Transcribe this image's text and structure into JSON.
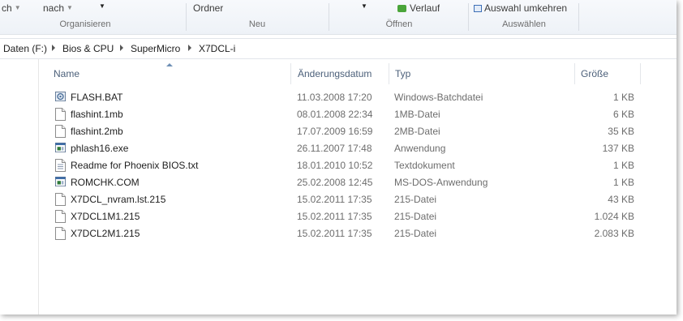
{
  "ribbon": {
    "top_cut": {
      "ch": "ch",
      "nach": "nach",
      "ordner": "Ordner",
      "verlauf": "Verlauf",
      "auswahl_umkehren": "Auswahl umkehren"
    },
    "groups": {
      "organisieren": "Organisieren",
      "neu": "Neu",
      "oeffnen": "Öffnen",
      "auswaehlen": "Auswählen"
    }
  },
  "address": {
    "crumbs": [
      "Daten (F:)",
      "Bios & CPU",
      "SuperMicro",
      "X7DCL-i"
    ]
  },
  "columns": {
    "name": "Name",
    "date": "Änderungsdatum",
    "type": "Typ",
    "size": "Größe"
  },
  "files": [
    {
      "name": "FLASH.BAT",
      "date": "11.03.2008 17:20",
      "type": "Windows-Batchdatei",
      "size": "1 KB",
      "icon": "batch-file-icon"
    },
    {
      "name": "flashint.1mb",
      "date": "08.01.2008 22:34",
      "type": "1MB-Datei",
      "size": "6 KB",
      "icon": "file-icon"
    },
    {
      "name": "flashint.2mb",
      "date": "17.07.2009 16:59",
      "type": "2MB-Datei",
      "size": "35 KB",
      "icon": "file-icon"
    },
    {
      "name": "phlash16.exe",
      "date": "26.11.2007 17:48",
      "type": "Anwendung",
      "size": "137 KB",
      "icon": "application-icon"
    },
    {
      "name": "Readme for Phoenix BIOS.txt",
      "date": "18.01.2010 10:52",
      "type": "Textdokument",
      "size": "1 KB",
      "icon": "text-file-icon"
    },
    {
      "name": "ROMCHK.COM",
      "date": "25.02.2008 12:45",
      "type": "MS-DOS-Anwendung",
      "size": "1 KB",
      "icon": "application-icon"
    },
    {
      "name": "X7DCL_nvram.lst.215",
      "date": "15.02.2011 17:35",
      "type": "215-Datei",
      "size": "43 KB",
      "icon": "file-icon"
    },
    {
      "name": "X7DCL1M1.215",
      "date": "15.02.2011 17:35",
      "type": "215-Datei",
      "size": "1.024 KB",
      "icon": "file-icon"
    },
    {
      "name": "X7DCL2M1.215",
      "date": "15.02.2011 17:35",
      "type": "215-Datei",
      "size": "2.083 KB",
      "icon": "file-icon"
    }
  ]
}
